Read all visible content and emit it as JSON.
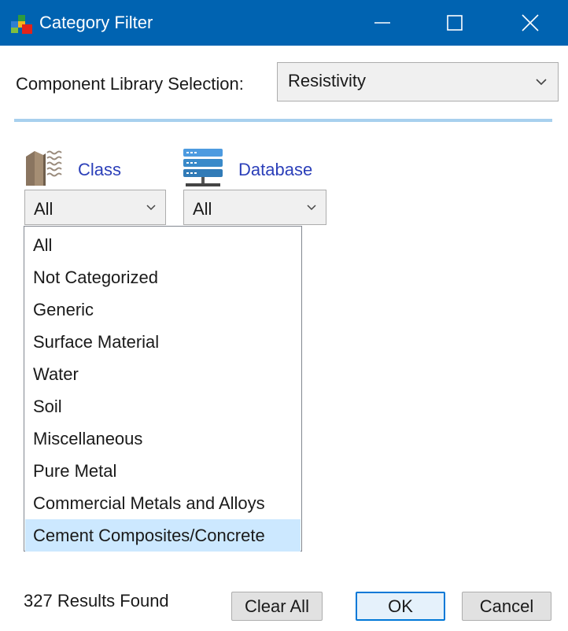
{
  "window": {
    "title": "Category Filter",
    "title_bg_color": "#0063b1",
    "controls": {
      "minimize_icon": "minimize-icon",
      "maximize_icon": "maximize-icon",
      "close_icon": "close-icon"
    }
  },
  "library": {
    "label": "Component Library Selection:",
    "selected": "Resistivity"
  },
  "filters": {
    "class": {
      "label": "Class",
      "icon": "class-material-icon",
      "selected": "All",
      "dropdown_open": true,
      "options": [
        "All",
        "Not Categorized",
        "Generic",
        "Surface Material",
        "Water",
        "Soil",
        "Miscellaneous",
        "Pure Metal",
        "Commercial Metals and Alloys",
        "Cement Composites/Concrete"
      ],
      "highlighted_option": "Cement Composites/Concrete"
    },
    "database": {
      "label": "Database",
      "icon": "database-server-icon",
      "selected": "All"
    }
  },
  "footer": {
    "results_text": "327 Results Found",
    "clear_all_label": "Clear All",
    "ok_label": "OK",
    "cancel_label": "Cancel"
  },
  "colors": {
    "link_label": "#2b3fb9",
    "separator": "#a8d0ee",
    "selection_highlight": "#cce8ff",
    "default_button_border": "#0078d7"
  }
}
